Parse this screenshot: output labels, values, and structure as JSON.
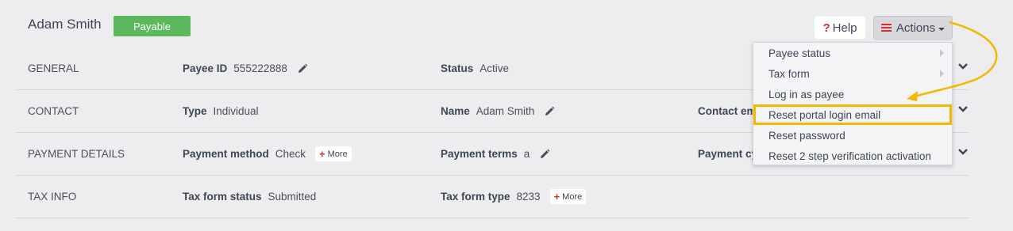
{
  "header": {
    "name": "Adam Smith",
    "badge": "Payable",
    "help_label": "Help",
    "help_mark": "?",
    "actions_label": "Actions"
  },
  "rows": [
    {
      "section": "GENERAL",
      "fields": [
        {
          "label": "Payee ID",
          "value": "555222888",
          "editable": true
        },
        {
          "label": "Status",
          "value": "Active"
        }
      ]
    },
    {
      "section": "CONTACT",
      "fields": [
        {
          "label": "Type",
          "value": "Individual"
        },
        {
          "label": "Name",
          "value": "Adam Smith",
          "editable": true
        },
        {
          "label": "Contact em"
        }
      ]
    },
    {
      "section": "PAYMENT DETAILS",
      "fields": [
        {
          "label": "Payment method",
          "value": "Check",
          "more": "More"
        },
        {
          "label": "Payment terms",
          "value": "a",
          "editable": true
        },
        {
          "label": "Payment cy"
        }
      ]
    },
    {
      "section": "TAX INFO",
      "fields": [
        {
          "label": "Tax form status",
          "value": "Submitted"
        },
        {
          "label": "Tax form type",
          "value": "8233",
          "more": "More"
        }
      ]
    }
  ],
  "actions_menu": {
    "items": [
      {
        "label": "Payee status",
        "submenu": true
      },
      {
        "label": "Tax form",
        "submenu": true
      },
      {
        "label": "Log in as payee"
      },
      {
        "label": "Reset portal login email",
        "highlighted": true
      },
      {
        "label": "Reset password"
      },
      {
        "label": "Reset 2 step verification activation"
      }
    ]
  },
  "colors": {
    "badge": "#5cb85c",
    "accent_red": "#d32f2f",
    "highlight": "#f5b700",
    "background": "#edecef"
  }
}
